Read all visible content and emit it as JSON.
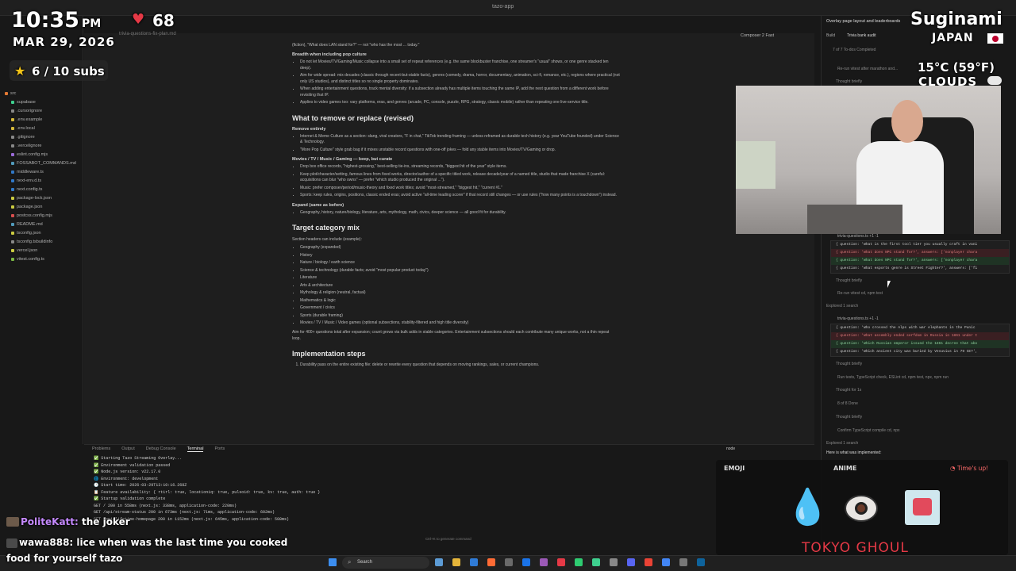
{
  "app": {
    "title": "tazo-app"
  },
  "explorer": {
    "files": [
      "src",
      "supabase",
      ".cursorignore",
      ".env.example",
      ".env.local",
      ".gitignore",
      ".vercelignore",
      "eslint.config.mjs",
      "FOSSABOT_COMMANDS.md",
      "middleware.ts",
      "next-env.d.ts",
      "next.config.ts",
      "package-lock.json",
      "package.json",
      "postcss.config.mjs",
      "README.md",
      "tsconfig.json",
      "tsconfig.tsbuildinfo",
      "vercel.json",
      "vitest.config.ts"
    ]
  },
  "editor": {
    "breadcrumb": "trivia-questions-fix-plan.md",
    "top_line": "(fiction), \"What does LAN stand for?\" — not \"who has the most ... today.\"",
    "breadth_heading": "Breadth when including pop culture",
    "breadth_items": [
      "Do not let Movies/TV/Gaming/Music collapse into a small set of repeat references (e.g. the same blockbuster franchise, one streamer's \"usual\" shows, or one genre stacked ten deep).",
      "Aim for wide spread: mix decades (classic through recent-but-stable facts), genres (comedy, drama, horror, documentary, animation, sci-fi, romance, etc.), regions where practical (not only US studios), and distinct titles so no single property dominates.",
      "When adding entertainment questions, track mental diversity: if a subsection already has multiple items touching the same IP, add the next question from a different work before revisiting that IP.",
      "Applies to video games too: vary platforms, eras, and genres (arcade, PC, console, puzzle, RPG, strategy, classic mobile) rather than repeating one live-service title."
    ],
    "remove_heading": "What to remove or replace (revised)",
    "remove_entirely": "Remove entirely",
    "remove_items": [
      "Internet & Meme Culture as a section: slang, viral creators, \"F in chat,\" TikTok trending framing — unless reframed as durable tech history (e.g. year YouTube founded) under Science & Technology.",
      "\"More Pop Culture\" style grab bag if it mixes unstable record questions with one-off jokes — fold any stable items into Movies/TV/Gaming or drop."
    ],
    "keep_heading": "Movies / TV / Music / Gaming — keep, but curate",
    "keep_items": [
      "Drop box office records, \"highest-grossing,\" best-selling tie-ins, streaming records, \"biggest hit of the year\" style items.",
      "Keep plot/character/setting, famous lines from fixed works, director/author of a specific titled work, release decade/year of a named title, studio that made franchise X (careful: acquisitions can blur \"who owns\" — prefer \"which studio produced the original ...\").",
      "Music: prefer composer/period/music-theory and fixed work titles; avoid \"most-streamed,\" \"biggest hit,\" \"current #1.\"",
      "Sports: keep rules, origins, positions, classic ended eras; avoid active \"all-time leading scorer\" if that record still changes — or use rules (\"how many points is a touchdown\") instead."
    ],
    "expand_heading": "Expand (same as before)",
    "expand_items": [
      "Geography, history, nature/biology, literature, arts, mythology, math, civics, deeper science — all good fit for durability."
    ],
    "target_heading": "Target category mix",
    "target_intro": "Section headers can include (example):",
    "target_items": [
      "Geography (expanded)",
      "History",
      "Nature / biology / earth science",
      "Science & technology (durable facts; avoid \"most popular product today\")",
      "Literature",
      "Arts & architecture",
      "Mythology & religion (neutral, factual)",
      "Mathematics & logic",
      "Government / civics",
      "Sports (durable framing)",
      "Movies / TV / Music / Video games (optional subsections, stability-filtered and high title diversity)"
    ],
    "target_note": "Aim for 400+ questions total after expansion; count grows via bulk adds in stable categories. Entertainment subsections should each contribute many unique works, not a thin repeat loop.",
    "impl_heading": "Implementation steps",
    "impl_items": [
      "Durability pass on the entire existing file: delete or rewrite every question that depends on moving rankings, sales, or current champions."
    ]
  },
  "chat": {
    "header": "Overlay page layout and leaderboards",
    "mode": "Composer 2 Fast",
    "build": "Build",
    "task": "Trivia bank audit",
    "todos": "7 of 7 To-dos Completed",
    "lines": [
      "Re-run vitest after marathon and...",
      "Thought briefly"
    ],
    "diff_label": "trivia-questions.ts +1 -1",
    "code1": [
      "{ question: 'What is the first tool tier you usually craft in vani",
      "{ question: 'What does NPC stand for?', answers: ['nonplayer chara",
      "{ question: 'What does NPC stand for?', answers: ['nonplayer chara",
      "{ question: 'What esports genre is Street Fighter?', answers: ['fi"
    ],
    "mid_lines": [
      "Thought briefly",
      "Re-run vitest  cd, npm test",
      "Explored 1 search"
    ],
    "diff_label2": "trivia-questions.ts +1 -1",
    "code2": [
      "{ question: 'Who crossed the Alps with war elephants in the Punic",
      "{ question: 'What assembly ended serfdom in Russia in 1861 under t",
      "{ question: 'Which Russian emperor issued the 1861 decree that abo",
      "{ question: 'Which ancient city was buried by Vesuvius in 79 CE?',"
    ],
    "tail_lines": [
      "Thought briefly",
      "Run tests, TypeScript check, ESLint  cd, npm test, npx, npm run",
      "Thought for 1s",
      "8 of 8 Done",
      "Thought briefly",
      "Confirm TypeScript compile  cd, npx",
      "Explored 1 search",
      "Here is what was implemented:"
    ]
  },
  "terminal": {
    "tabs": [
      "Problems",
      "Output",
      "Debug Console",
      "Terminal",
      "Ports"
    ],
    "active_tab": "Terminal",
    "shell": "node",
    "lines": [
      "✅ Starting Tazo Streaming Overlay...",
      "✅ Environment validation passed",
      "✅ Node.js version: v22.17.0",
      "🌐 Environment: development",
      "🕐 Start time: 2026-03-29T13:10:16.268Z",
      "📋 Feature availability: { rtirl: true, locationiq: true, pulsoid: true, kv: true, auth: true }",
      "✅ Startup validation complete",
      " GET / 200 in 558ms (next.js: 338ms, application-code: 220ms)",
      " GET /api/stream-status 200 in 673ms (next.js: 71ms, application-code: 602ms)",
      " GET /api/lifetime-homepage 200 in 1152ms (next.js: 645ms, application-code: 508ms)"
    ],
    "hint": "Ctrl+K to generate command"
  },
  "overlay": {
    "time": "10:35",
    "ampm": "PM",
    "date": "MAR 29, 2026",
    "heart_rate": "68",
    "subs": "6 / 10 subs",
    "city": "Suginami",
    "country": "JAPAN",
    "temp": "15°C (59°F)",
    "weather": "CLOUDS"
  },
  "quiz": {
    "category_left": "EMOJI",
    "category_right": "ANIME",
    "timer": "Time's up!",
    "answer": "TOKYO GHOUL"
  },
  "stream_chat": [
    {
      "user": "PoliteKatt:",
      "text": "the joker"
    },
    {
      "user": "wawa888:",
      "text": "lice when was the last time you cooked"
    },
    {
      "user": "",
      "text": "food for yourself tazo"
    }
  ],
  "taskbar": {
    "search": "Search"
  },
  "colors": {
    "accent": "#0e639c",
    "heart": "#e53946",
    "star": "#f5c518"
  }
}
